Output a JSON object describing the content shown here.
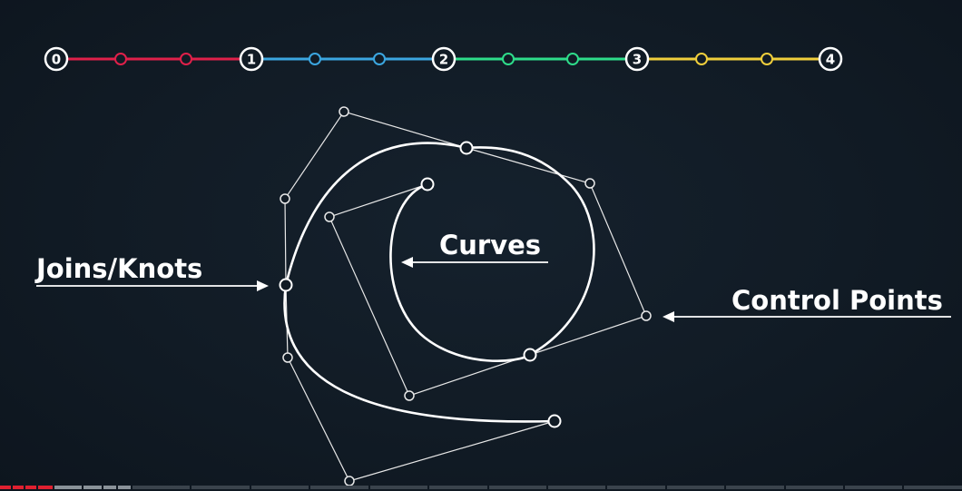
{
  "timeline": {
    "knots": [
      "0",
      "1",
      "2",
      "3",
      "4"
    ],
    "segment_colors": [
      "#e0204a",
      "#3ba6e0",
      "#2edc8a",
      "#f0cf3c"
    ]
  },
  "labels": {
    "joins": "Joins/Knots",
    "curves": "Curves",
    "control_points": "Control Points"
  },
  "colors": {
    "background": "#111b25",
    "curve": "#ffffff",
    "hull": "#e8e8e8",
    "progress_played": "#e02030"
  },
  "player": {
    "progress_fraction": 0.05
  }
}
